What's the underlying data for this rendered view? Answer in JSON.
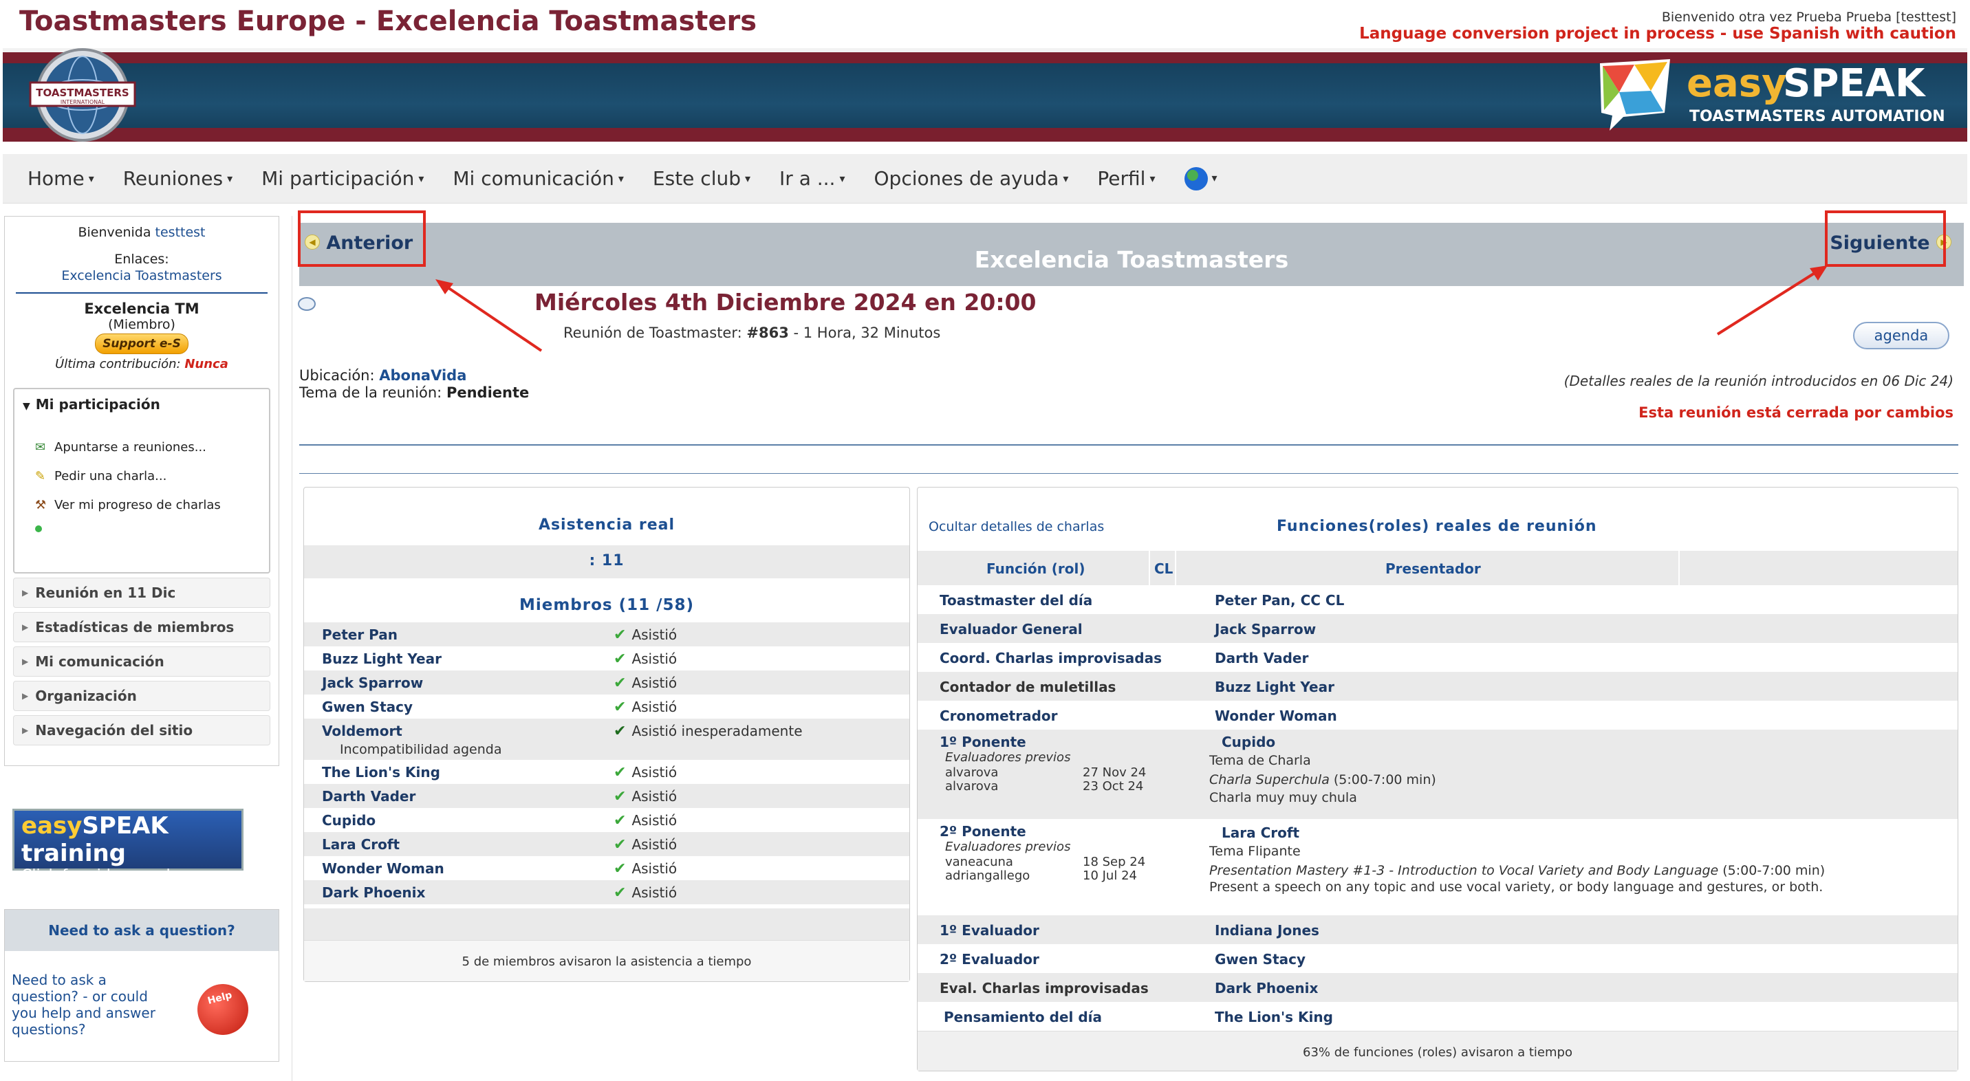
{
  "header": {
    "site_title": "Toastmasters Europe - Excelencia Toastmasters",
    "welcome": "Bienvenido otra vez Prueba Prueba  [testtest]",
    "warning": "Language conversion project in process - use Spanish with caution",
    "ti_logo_text": "TOASTMASTERS",
    "ti_logo_sub": "INTERNATIONAL",
    "es_logo_easy": "easy",
    "es_logo_speak": "SPEAK",
    "es_logo_tag": "TOASTMASTERS AUTOMATION"
  },
  "nav": {
    "items": [
      "Home",
      "Reuniones",
      "Mi participación",
      "Mi comunicación",
      "Este club",
      "Ir a ...",
      "Opciones de ayuda",
      "Perfil"
    ]
  },
  "sidebar": {
    "welcome_label": "Bienvenida",
    "username": "testtest",
    "links_label": "Enlaces:",
    "club_link": "Excelencia Toastmasters",
    "club_name": "Excelencia TM",
    "member_status": "(Miembro)",
    "support_btn": "Support e-S",
    "last_contrib_label": "Última contribución:",
    "last_contrib_value": "Nunca",
    "my_part_title": "Mi participación",
    "my_part_items": [
      "Apuntarse a reuniones...",
      "Pedir una charla...",
      "Ver mi progreso de charlas"
    ],
    "collapsed_panels": [
      "Reunión en 11 Dic",
      "Estadísticas de miembros",
      "Mi comunicación",
      "Organización",
      "Navegación del sitio"
    ],
    "training_easy": "easy",
    "training_speak": "SPEAK training",
    "training_sub": "Click for videos and webinars",
    "question_title": "Need to ask a question?",
    "question_body": "Need to ask a question? - or could you help and answer questions?",
    "help_btn": "Help"
  },
  "main": {
    "prev": "Anterior",
    "next": "Siguiente",
    "club_title": "Excelencia Toastmasters",
    "meeting_date": "Miércoles 4th Diciembre 2024 en 20:00",
    "meeting_sub_prefix": "Reunión de Toastmaster:",
    "meeting_number": "#863",
    "meeting_duration": "- 1 Hora, 32 Minutos",
    "agenda_btn": "agenda",
    "location_label": "Ubicación:",
    "location_value": "AbonaVida",
    "theme_label": "Tema de la reunión:",
    "theme_value": "Pendiente",
    "details_note": "(Detalles reales de la reunión introducidos en 06 Dic 24)",
    "closed_note": "Esta reunión está cerrada por cambios"
  },
  "attendance": {
    "title": "Asistencia real",
    "count": ": 11",
    "members_title": "Miembros (11 /58)",
    "rows": [
      {
        "name": "Peter Pan",
        "status": "Asistió"
      },
      {
        "name": "Buzz Light Year",
        "status": "Asistió"
      },
      {
        "name": "Jack Sparrow",
        "status": "Asistió"
      },
      {
        "name": "Gwen Stacy",
        "status": "Asistió"
      },
      {
        "name": "Voldemort",
        "status": "Asistió inesperadamente",
        "note": "Incompatibilidad agenda"
      },
      {
        "name": "The Lion's King",
        "status": "Asistió"
      },
      {
        "name": "Darth Vader",
        "status": "Asistió"
      },
      {
        "name": "Cupido",
        "status": "Asistió"
      },
      {
        "name": "Lara Croft",
        "status": "Asistió"
      },
      {
        "name": "Wonder Woman",
        "status": "Asistió"
      },
      {
        "name": "Dark Phoenix",
        "status": "Asistió"
      }
    ],
    "footer": "5 de miembros avisaron la asistencia a tiempo"
  },
  "roles": {
    "hide_link": "Ocultar detalles de charlas",
    "title": "Funciones(roles) reales de reunión",
    "col_function": "Función (rol)",
    "col_cl": "CL",
    "col_presenter": "Presentador",
    "rows": [
      {
        "function": "Toastmaster del día",
        "presenter": "Peter Pan, CC CL"
      },
      {
        "function": "Evaluador General",
        "presenter": "Jack Sparrow"
      },
      {
        "function": "Coord. Charlas improvisadas",
        "presenter": "Darth Vader"
      },
      {
        "function": "Contador de muletillas",
        "presenter": "Buzz Light Year"
      },
      {
        "function": "Cronometrador",
        "presenter": "Wonder Woman"
      }
    ],
    "speaker1": {
      "function": "1º Ponente",
      "prev_label": "Evaluadores previos",
      "evaluators": [
        {
          "name": "alvarova",
          "date": "27 Nov 24"
        },
        {
          "name": "alvarova",
          "date": "23 Oct 24"
        }
      ],
      "presenter": "Cupido",
      "speech_label": "Tema de Charla",
      "speech_title": "Charla Superchula",
      "speech_time": "(5:00-7:00 min)",
      "speech_desc": "Charla muy muy chula"
    },
    "speaker2": {
      "function": "2º Ponente",
      "prev_label": "Evaluadores previos",
      "evaluators": [
        {
          "name": "vaneacuna",
          "date": "18 Sep 24"
        },
        {
          "name": "adriangallego",
          "date": "10 Jul 24"
        }
      ],
      "presenter": "Lara Croft",
      "speech_label": "Tema Flipante",
      "speech_title": "Presentation Mastery #1-3 - Introduction to Vocal Variety and Body Language",
      "speech_time": "(5:00-7:00 min)",
      "speech_desc": "Present a speech on any topic and use vocal variety, or body language and gestures, or both."
    },
    "rows2": [
      {
        "function": "1º Evaluador",
        "presenter": "Indiana Jones"
      },
      {
        "function": "2º Evaluador",
        "presenter": "Gwen Stacy"
      },
      {
        "function": "Eval. Charlas improvisadas",
        "presenter": "Dark Phoenix"
      },
      {
        "function": "Pensamiento del día",
        "presenter": "The Lion's King"
      }
    ],
    "footer": "63% de funciones (roles) avisaron a tiempo"
  },
  "colors": {
    "maroon": "#7a2335",
    "navy": "#1d4f91",
    "alert_red": "#d0241b",
    "annotation_red": "#e0281f"
  }
}
